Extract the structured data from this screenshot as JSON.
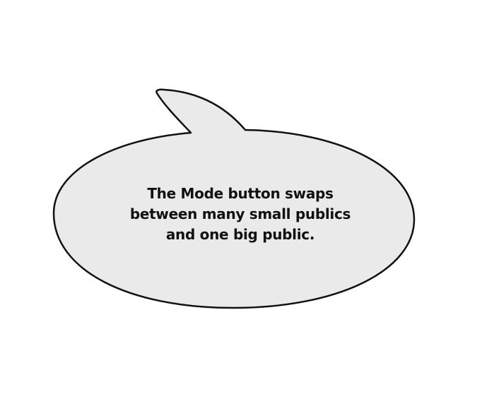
{
  "bubble": {
    "lines": [
      "The Mode button swaps",
      "between many small publics",
      "and one big public."
    ],
    "fill_color": "#eaeaea",
    "stroke_color": "#111111"
  }
}
